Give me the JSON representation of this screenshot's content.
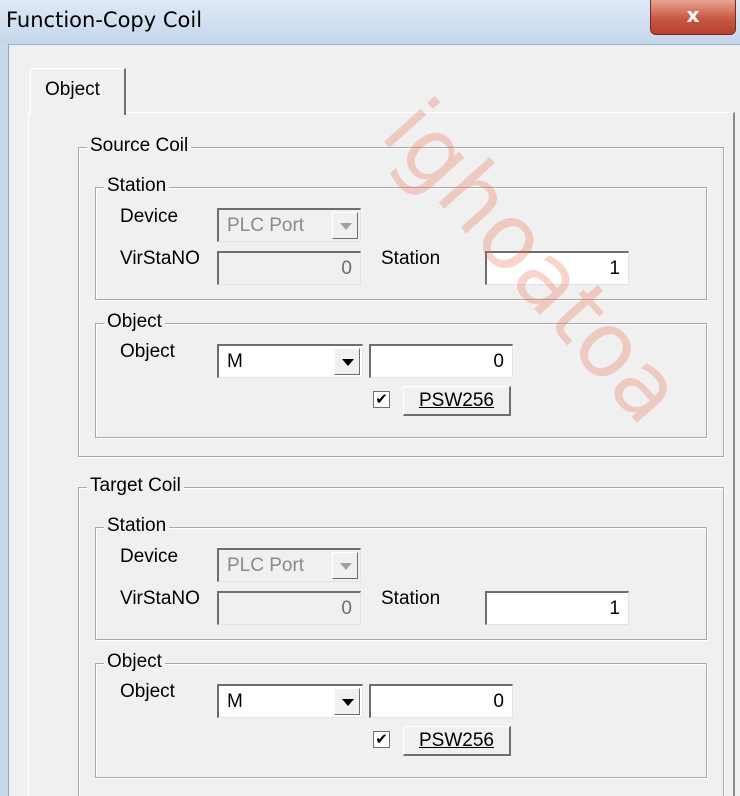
{
  "window": {
    "title": "Function-Copy Coil",
    "close_glyph": "x"
  },
  "tab": {
    "label": "Object"
  },
  "watermark": "ighoatoa",
  "source": {
    "legend": "Source Coil",
    "station_legend": "Station",
    "device_label": "Device",
    "device_value": "PLC Port",
    "virsta_label": "VirStaNO",
    "virsta_value": "0",
    "station_label": "Station",
    "station_value": "1",
    "object_legend": "Object",
    "object_label": "Object",
    "object_type": "M",
    "object_value": "0",
    "psw_checked": "✔",
    "psw_label": "PSW256"
  },
  "target": {
    "legend": "Target Coil",
    "station_legend": "Station",
    "device_label": "Device",
    "device_value": "PLC Port",
    "virsta_label": "VirStaNO",
    "virsta_value": "0",
    "station_label": "Station",
    "station_value": "1",
    "object_legend": "Object",
    "object_label": "Object",
    "object_type": "M",
    "object_value": "0",
    "psw_checked": "✔",
    "psw_label": "PSW256"
  }
}
